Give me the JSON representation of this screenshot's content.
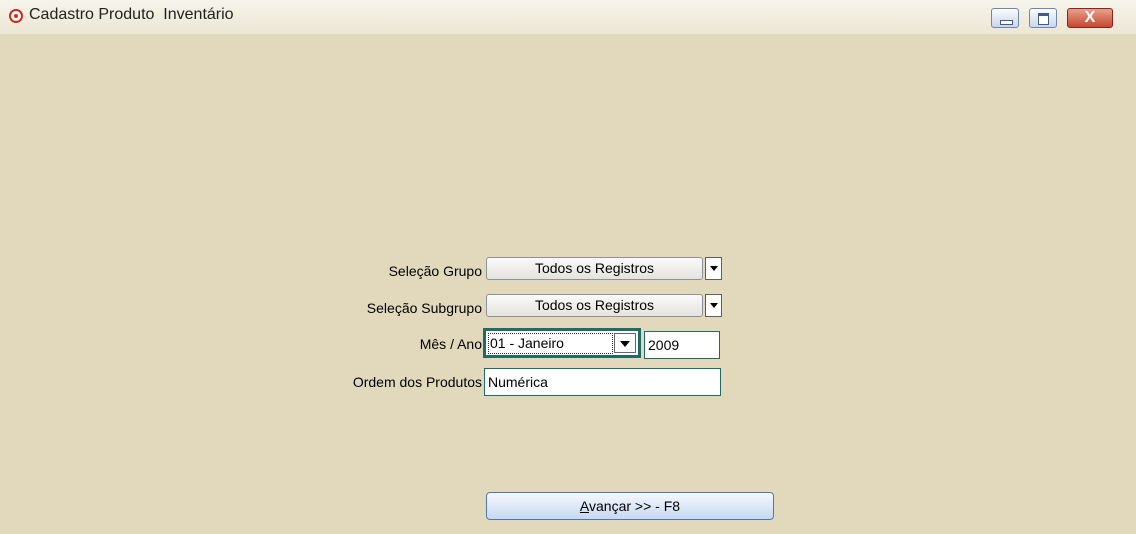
{
  "window": {
    "title": "Cadastro Produto  Inventário",
    "close_glyph": "X"
  },
  "form": {
    "grupo": {
      "label": "Seleção Grupo",
      "value": "Todos os Registros"
    },
    "subgrupo": {
      "label": "Seleção Subgrupo",
      "value": "Todos os Registros"
    },
    "mes_ano": {
      "label": "Mês / Ano",
      "month": "01 - Janeiro",
      "year": "2009"
    },
    "ordem": {
      "label": "Ordem dos Produtos",
      "value": "Numérica"
    }
  },
  "actions": {
    "next_accel": "A",
    "next_rest": "vançar >> - F8"
  }
}
